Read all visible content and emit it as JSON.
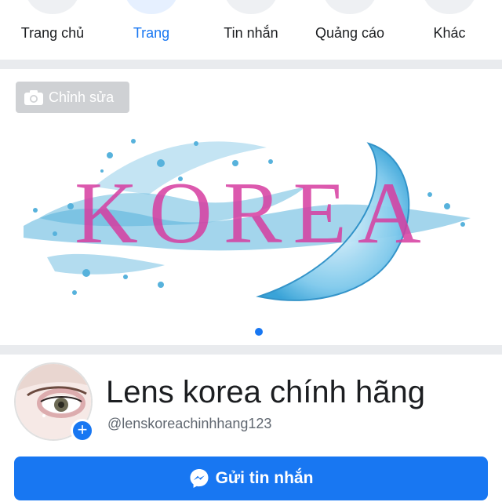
{
  "nav": {
    "items": [
      {
        "label": "Trang chủ"
      },
      {
        "label": "Trang"
      },
      {
        "label": "Tin nhắn"
      },
      {
        "label": "Quảng cáo"
      },
      {
        "label": "Khác"
      }
    ],
    "active_index": 1
  },
  "cover": {
    "edit_label": "Chỉnh sửa",
    "edit_icon": "camera-icon",
    "artwork_text": "KOREA"
  },
  "profile": {
    "name": "Lens korea chính hãng",
    "username": "@lenskoreachinhhang123",
    "add_icon": "plus-icon"
  },
  "actions": {
    "message_label": "Gửi tin nhắn",
    "message_icon": "messenger-icon"
  },
  "colors": {
    "accent": "#1877f2",
    "text": "#1c1e21",
    "muted": "#606770"
  }
}
